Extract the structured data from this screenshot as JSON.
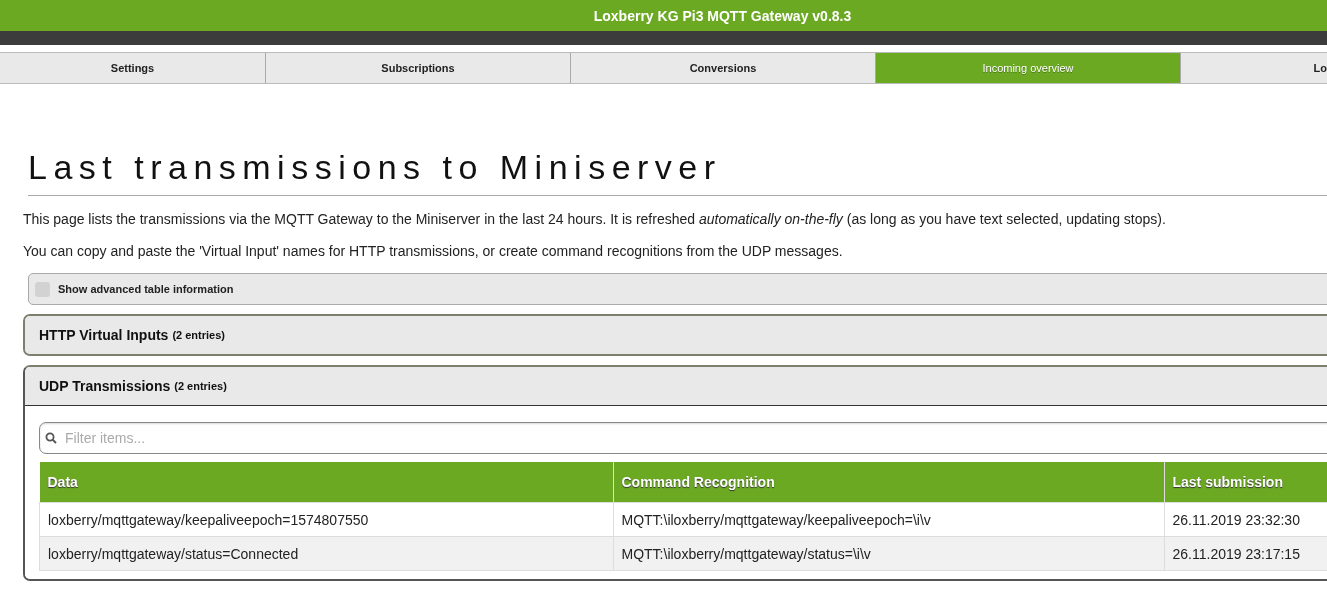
{
  "header": {
    "title": "Loxberry KG Pi3 MQTT Gateway v0.8.3"
  },
  "tabs": [
    {
      "label": "Settings",
      "selected": false
    },
    {
      "label": "Subscriptions",
      "selected": false
    },
    {
      "label": "Conversions",
      "selected": false
    },
    {
      "label": "Incoming overview",
      "selected": true
    },
    {
      "label": "Lo",
      "selected": false
    }
  ],
  "page": {
    "heading": "Last transmissions to Miniserver",
    "paragraphs": [
      "This page lists the transmissions via the MQTT Gateway to the Miniserver in the last 24 hours. It is refreshed *automatically on-the-fly* (as long as you have text selected, updating stops).",
      "You can copy and paste the 'Virtual Input' names for HTTP transmissions, or create command recognitions from the UDP messages."
    ],
    "advanced_checkbox": {
      "label": "Show advanced table information",
      "checked": false
    }
  },
  "sections": [
    {
      "title": "HTTP Virtual Inputs",
      "count": "(2 entries)",
      "expanded": false
    },
    {
      "title": "UDP Transmissions",
      "count": "(2 entries)",
      "expanded": true,
      "filter": {
        "placeholder": "Filter items..."
      },
      "table": {
        "columns": [
          "Data",
          "Command Recognition",
          "Last submission"
        ],
        "rows": [
          [
            "loxberry/mqttgateway/keepaliveepoch=1574807550",
            "MQTT:\\iloxberry/mqttgateway/keepaliveepoch=\\i\\v",
            "26.11.2019 23:32:30"
          ],
          [
            "loxberry/mqttgateway/status=Connected",
            "MQTT:\\iloxberry/mqttgateway/status=\\i\\v",
            "26.11.2019 23:17:15"
          ]
        ]
      }
    }
  ]
}
